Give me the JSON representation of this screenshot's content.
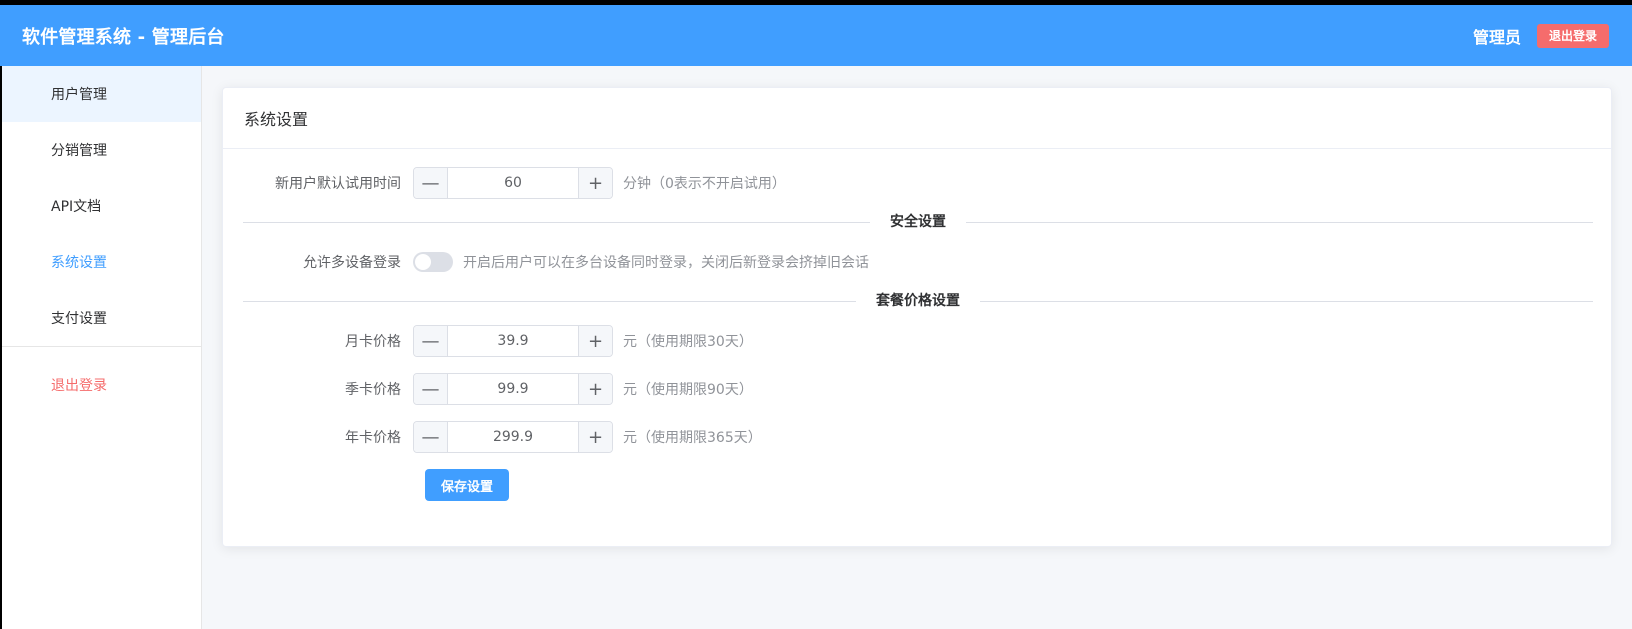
{
  "header": {
    "title": "软件管理系统 - 管理后台",
    "user": "管理员",
    "logout_label": "退出登录"
  },
  "sidebar": {
    "items": [
      {
        "label": "用户管理"
      },
      {
        "label": "分销管理"
      },
      {
        "label": "API文档"
      },
      {
        "label": "系统设置"
      },
      {
        "label": "支付设置"
      }
    ],
    "logout_label": "退出登录"
  },
  "card": {
    "title": "系统设置",
    "trial": {
      "label": "新用户默认试用时间",
      "value": "60",
      "hint": "分钟（0表示不开启试用）"
    },
    "security_divider": "安全设置",
    "multi_device": {
      "label": "允许多设备登录",
      "enabled": false,
      "hint": "开启后用户可以在多台设备同时登录，关闭后新登录会挤掉旧会话"
    },
    "pricing_divider": "套餐价格设置",
    "monthly": {
      "label": "月卡价格",
      "value": "39.9",
      "hint": "元（使用期限30天）"
    },
    "quarterly": {
      "label": "季卡价格",
      "value": "99.9",
      "hint": "元（使用期限90天）"
    },
    "yearly": {
      "label": "年卡价格",
      "value": "299.9",
      "hint": "元（使用期限365天）"
    },
    "save_label": "保存设置",
    "minus_glyph": "—",
    "plus_glyph": "+"
  },
  "colors": {
    "primary": "#409eff",
    "danger": "#f56c6c"
  }
}
